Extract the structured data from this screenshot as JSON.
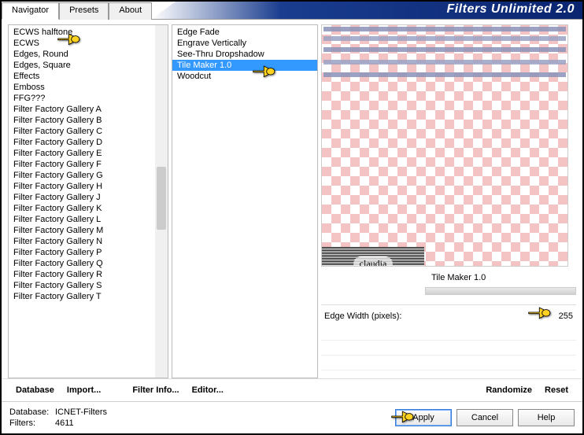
{
  "app_title": "Filters Unlimited 2.0",
  "tabs": {
    "t0": "Navigator",
    "t1": "Presets",
    "t2": "About"
  },
  "pane1": [
    "ECWS halftone",
    "ECWS",
    "Edges, Round",
    "Edges, Square",
    "Effects",
    "Emboss",
    "FFG???",
    "Filter Factory Gallery A",
    "Filter Factory Gallery B",
    "Filter Factory Gallery C",
    "Filter Factory Gallery D",
    "Filter Factory Gallery E",
    "Filter Factory Gallery F",
    "Filter Factory Gallery G",
    "Filter Factory Gallery H",
    "Filter Factory Gallery J",
    "Filter Factory Gallery K",
    "Filter Factory Gallery L",
    "Filter Factory Gallery M",
    "Filter Factory Gallery N",
    "Filter Factory Gallery P",
    "Filter Factory Gallery Q",
    "Filter Factory Gallery R",
    "Filter Factory Gallery S",
    "Filter Factory Gallery T"
  ],
  "pane2": [
    "Edge Fade",
    "Engrave Vertically",
    "See-Thru Dropshadow",
    "Tile Maker 1.0",
    "Woodcut"
  ],
  "pane2_selected_index": 3,
  "badge_text": "claudia",
  "filter_title": "Tile Maker 1.0",
  "param": {
    "label": "Edge Width (pixels):",
    "value": "255"
  },
  "row1": {
    "database": "Database",
    "import": "Import...",
    "filterinfo": "Filter Info...",
    "editor": "Editor...",
    "randomize": "Randomize",
    "reset": "Reset"
  },
  "status": {
    "db_label": "Database:",
    "db_value": "ICNET-Filters",
    "filters_label": "Filters:",
    "filters_value": "4611"
  },
  "buttons": {
    "apply": "Apply",
    "cancel": "Cancel",
    "help": "Help"
  }
}
